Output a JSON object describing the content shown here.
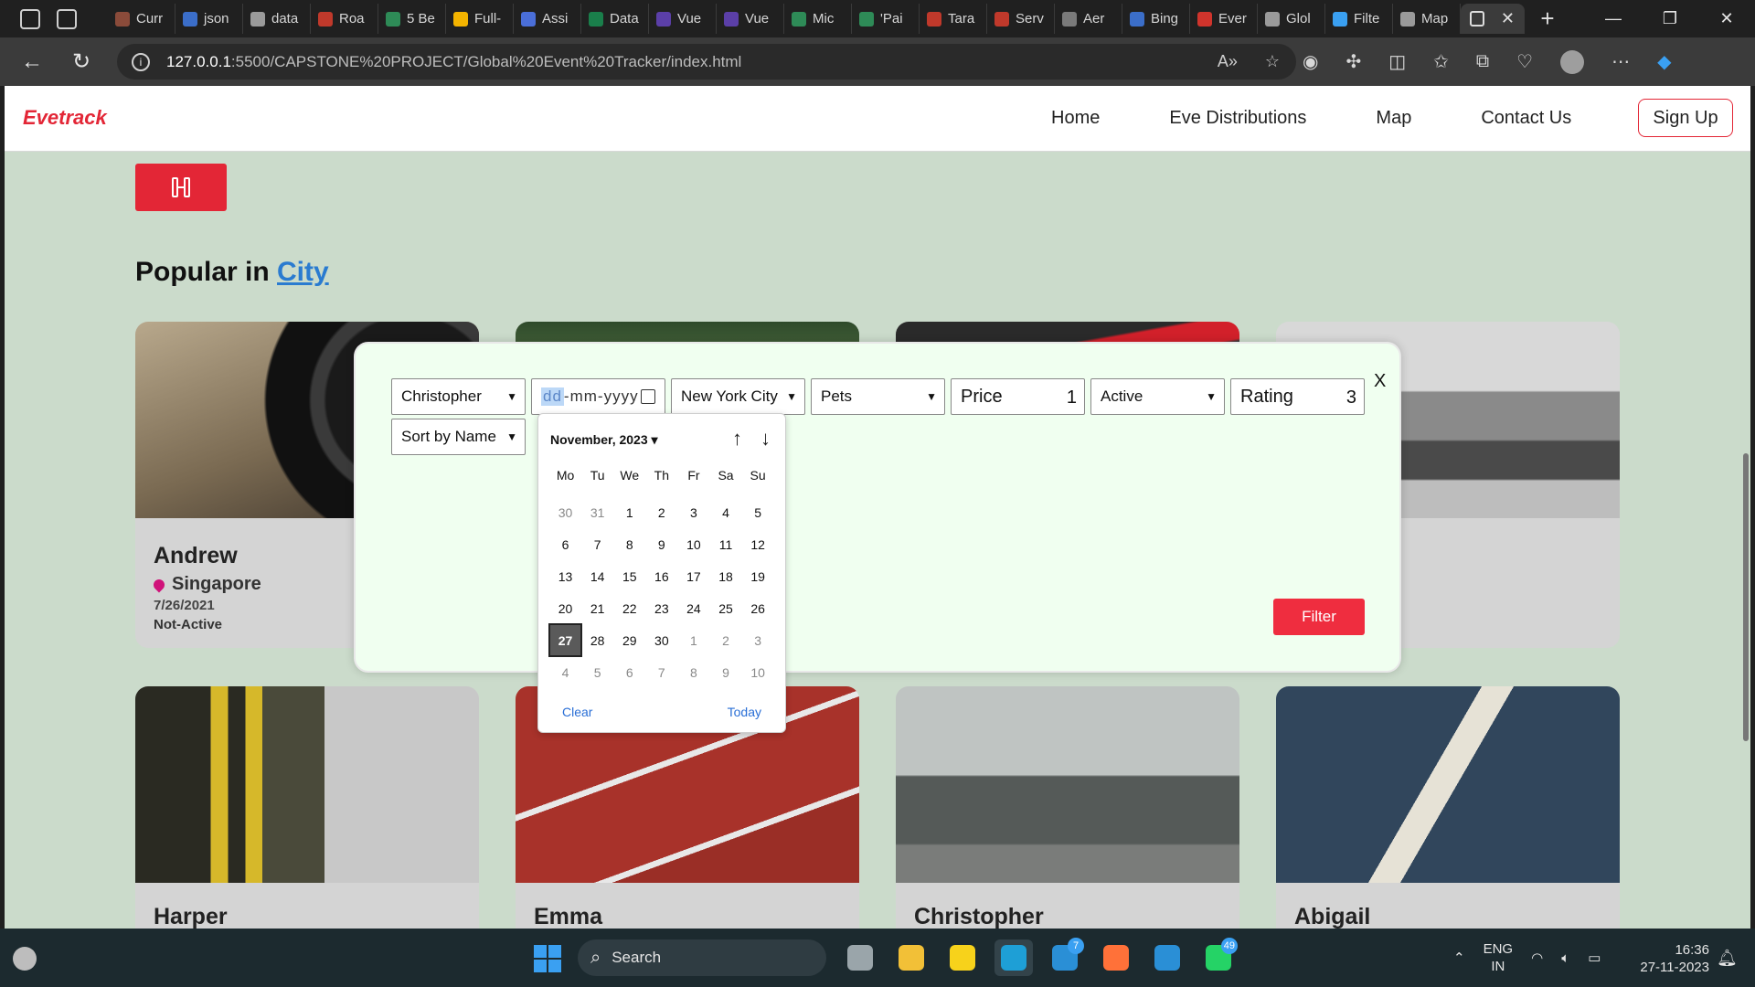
{
  "browser": {
    "tabs": [
      {
        "label": "Curr",
        "color": "#8a4b3a"
      },
      {
        "label": "json",
        "color": "#3b6ec9"
      },
      {
        "label": "data",
        "color": "#9a9a9a"
      },
      {
        "label": "Roa",
        "color": "#c0392b"
      },
      {
        "label": "5 Be",
        "color": "#2e8b57"
      },
      {
        "label": "Full-",
        "color": "#f4b400"
      },
      {
        "label": "Assi",
        "color": "#4a6ed8"
      },
      {
        "label": "Data",
        "color": "#1a7f4b"
      },
      {
        "label": "Vue",
        "color": "#5b3fa8"
      },
      {
        "label": "Vue",
        "color": "#5b3fa8"
      },
      {
        "label": "Mic",
        "color": "#2e8b57"
      },
      {
        "label": "'Pai",
        "color": "#2e8b57"
      },
      {
        "label": "Tara",
        "color": "#c0392b"
      },
      {
        "label": "Serv",
        "color": "#c0392b"
      },
      {
        "label": "Aer",
        "color": "#7a7a7a"
      },
      {
        "label": "Bing",
        "color": "#3b6ec9"
      },
      {
        "label": "Ever",
        "color": "#d0342c"
      },
      {
        "label": "Glol",
        "color": "#9a9a9a"
      },
      {
        "label": "Filte",
        "color": "#3aa0f2"
      },
      {
        "label": "Map",
        "color": "#9a9a9a"
      }
    ],
    "active_tab_close": "✕",
    "new_tab": "+",
    "url_host": "127.0.0.1",
    "url_path": ":5500/CAPSTONE%20PROJECT/Global%20Event%20Tracker/index.html",
    "window_controls": [
      "—",
      "❐",
      "✕"
    ]
  },
  "site": {
    "brand": "Evetrack",
    "nav": [
      "Home",
      "Eve Distributions",
      "Map",
      "Contact Us"
    ],
    "signup": "Sign Up",
    "filter_toggle_icon": "filter-sliders-icon",
    "section_title_prefix": "Popular in ",
    "section_title_link": "City"
  },
  "cards": [
    {
      "name": "Andrew",
      "location": "Singapore",
      "date": "7/26/2021",
      "status": "Not-Active",
      "image": "camera-lens-photo"
    },
    {
      "name": "",
      "image": "forest-photo"
    },
    {
      "name": "",
      "image": "red-car-photo"
    },
    {
      "name": "",
      "image": "surfers-photo"
    },
    {
      "name": "Harper",
      "image": "train-photo"
    },
    {
      "name": "Emma",
      "image": "running-track-photo"
    },
    {
      "name": "Christopher",
      "image": "traffic-cone-photo"
    },
    {
      "name": "Abigail",
      "image": "number-seven-photo"
    }
  ],
  "filter_modal": {
    "close": "X",
    "name_select": "Christopher",
    "date_placeholder_day": "dd",
    "date_placeholder_rest": "-mm-yyyy",
    "city_select": "New York City",
    "category_select": "Pets",
    "price_label": "Price",
    "price_value": "1",
    "status_select": "Active",
    "rating_label": "Rating",
    "rating_value": "3",
    "sort_select": "Sort by Name",
    "filter_button": "Filter"
  },
  "date_picker": {
    "month_label": "November, 2023 ▾",
    "up": "↑",
    "down": "↓",
    "weekdays": [
      "Mo",
      "Tu",
      "We",
      "Th",
      "Fr",
      "Sa",
      "Su"
    ],
    "days": [
      {
        "d": "30",
        "other": true
      },
      {
        "d": "31",
        "other": true
      },
      {
        "d": "1"
      },
      {
        "d": "2"
      },
      {
        "d": "3"
      },
      {
        "d": "4"
      },
      {
        "d": "5"
      },
      {
        "d": "6"
      },
      {
        "d": "7"
      },
      {
        "d": "8"
      },
      {
        "d": "9"
      },
      {
        "d": "10"
      },
      {
        "d": "11"
      },
      {
        "d": "12"
      },
      {
        "d": "13"
      },
      {
        "d": "14"
      },
      {
        "d": "15"
      },
      {
        "d": "16"
      },
      {
        "d": "17"
      },
      {
        "d": "18"
      },
      {
        "d": "19"
      },
      {
        "d": "20"
      },
      {
        "d": "21"
      },
      {
        "d": "22"
      },
      {
        "d": "23"
      },
      {
        "d": "24"
      },
      {
        "d": "25"
      },
      {
        "d": "26"
      },
      {
        "d": "27",
        "selected": true
      },
      {
        "d": "28"
      },
      {
        "d": "29"
      },
      {
        "d": "30"
      },
      {
        "d": "1",
        "other": true
      },
      {
        "d": "2",
        "other": true
      },
      {
        "d": "3",
        "other": true
      },
      {
        "d": "4",
        "other": true
      },
      {
        "d": "5",
        "other": true
      },
      {
        "d": "6",
        "other": true
      },
      {
        "d": "7",
        "other": true
      },
      {
        "d": "8",
        "other": true
      },
      {
        "d": "9",
        "other": true
      },
      {
        "d": "10",
        "other": true
      }
    ],
    "clear": "Clear",
    "today": "Today"
  },
  "taskbar": {
    "search_label": "Search",
    "apps": [
      {
        "name": "task-view",
        "color": "#9aa5aa"
      },
      {
        "name": "file-explorer",
        "color": "#f2c037"
      },
      {
        "name": "sticky-notes",
        "color": "#f7d21b"
      },
      {
        "name": "edge",
        "color": "#1e9fd6",
        "active": true
      },
      {
        "name": "vscode-insiders",
        "color": "#2a8fd6",
        "badge": "7"
      },
      {
        "name": "firefox",
        "color": "#ff7139"
      },
      {
        "name": "vscode",
        "color": "#2a8fd6"
      },
      {
        "name": "whatsapp",
        "color": "#25d366",
        "badge": "49"
      }
    ],
    "lang_line1": "ENG",
    "lang_line2": "IN",
    "time": "16:36",
    "date": "27-11-2023"
  },
  "colors": {
    "accent": "#e32636",
    "page_bg": "#cbdbcb",
    "modal_bg": "#f0fff0",
    "link": "#2a7bd0"
  }
}
